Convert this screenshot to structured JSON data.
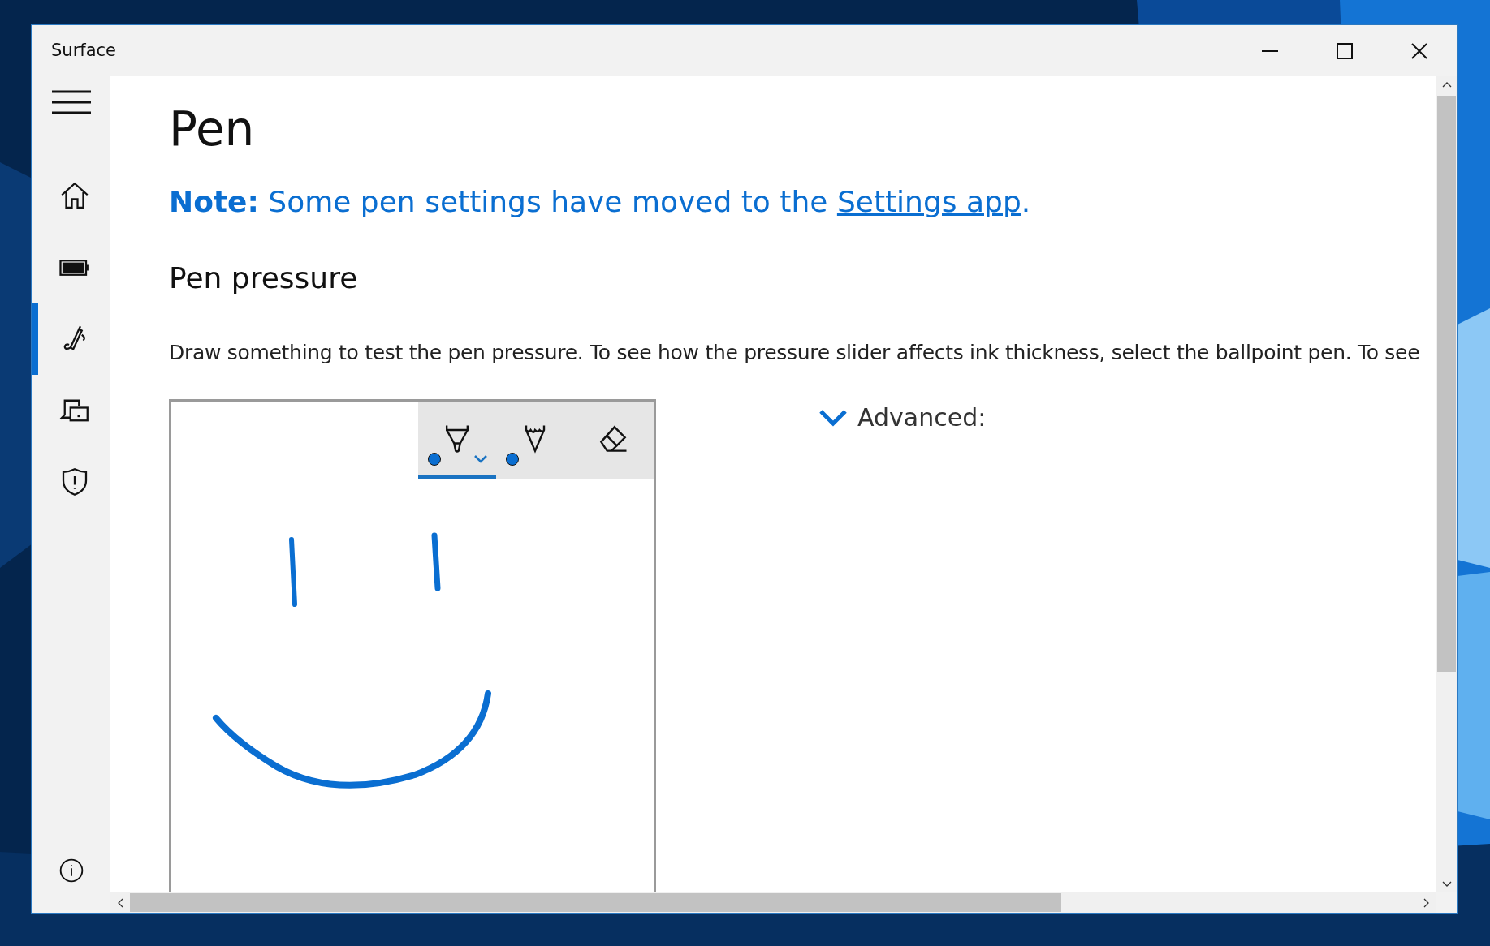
{
  "window": {
    "title": "Surface"
  },
  "nav": [
    {
      "kind": "home",
      "selected": false
    },
    {
      "kind": "battery",
      "selected": false
    },
    {
      "kind": "pen",
      "selected": true
    },
    {
      "kind": "devices",
      "selected": false
    },
    {
      "kind": "shield",
      "selected": false
    }
  ],
  "page": {
    "title": "Pen",
    "note": {
      "text": "**Note:** Some pen settings have moved to the",
      "link": "Settings app",
      "end": "."
    },
    "section": "Pen pressure",
    "description": "Draw something to test the pen pressure. To see how the pressure slider affects ink thickness, select the ballpoint pen. To see",
    "tools": [
      {
        "kind": "ballpoint",
        "selected": true,
        "color": "#0a6ed1"
      },
      {
        "kind": "pencil",
        "selected": false,
        "color": "#0a6ed1"
      },
      {
        "kind": "eraser",
        "selected": false
      }
    ],
    "advanced": {
      "label": "Advanced:",
      "expanded": false
    }
  }
}
